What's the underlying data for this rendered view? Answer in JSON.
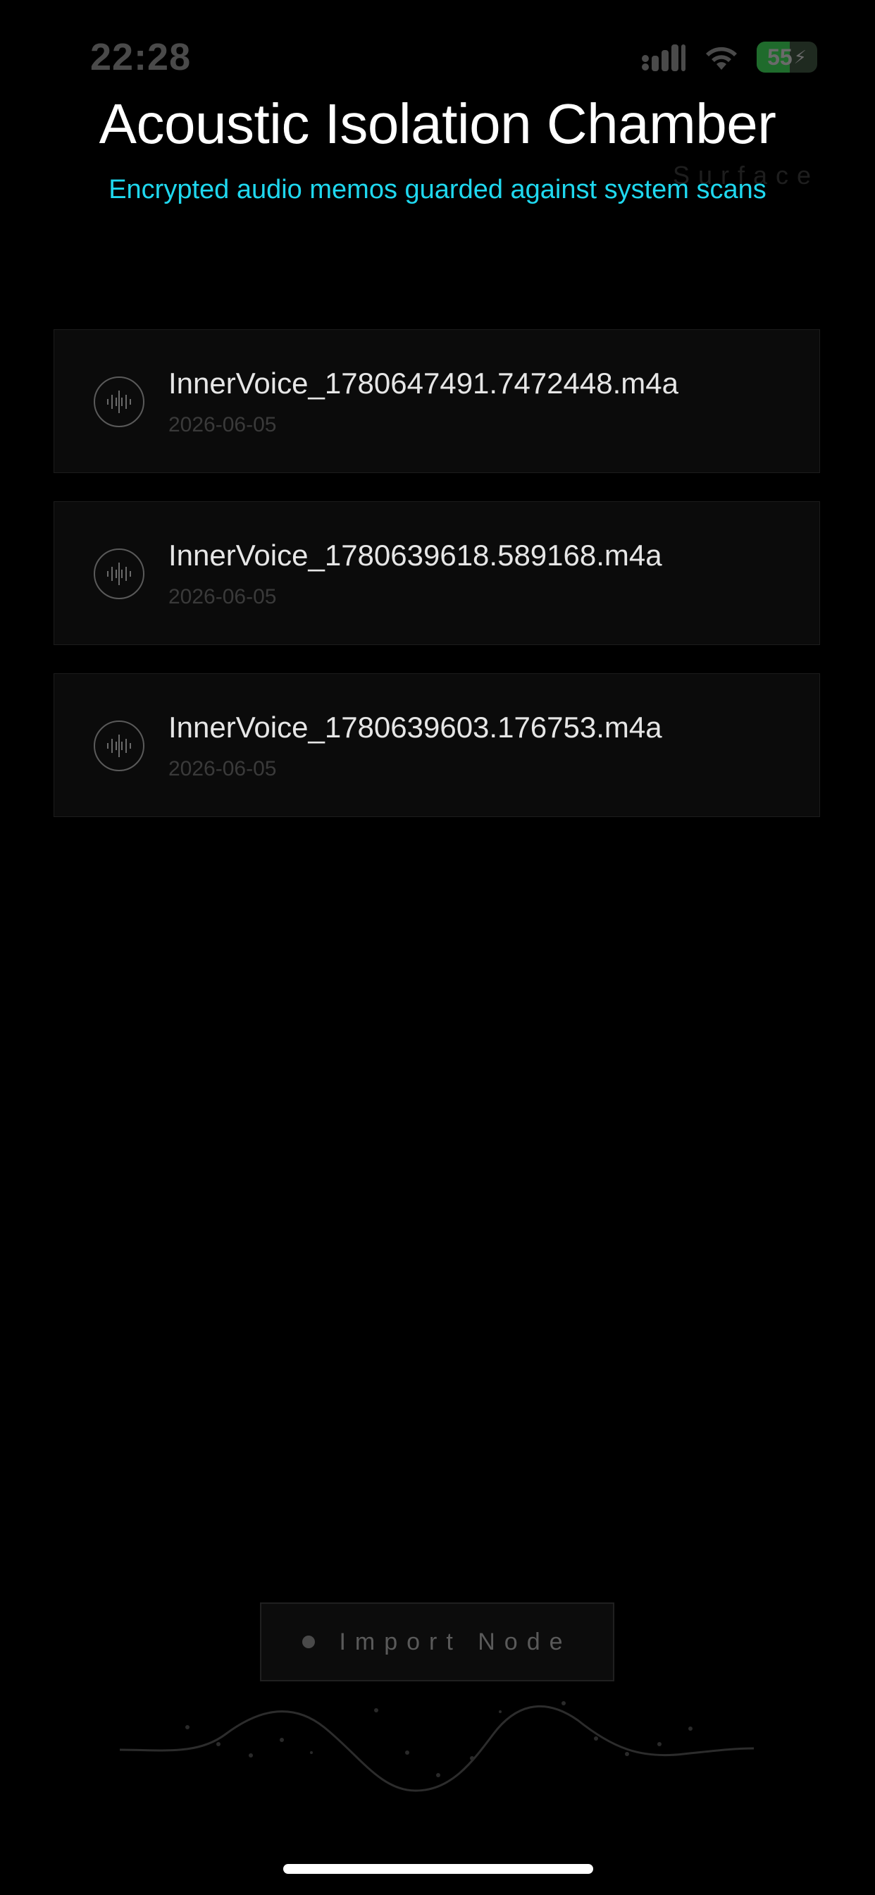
{
  "status_bar": {
    "time": "22:28",
    "battery_level": "55",
    "icons": [
      "signal-icon",
      "wifi-icon",
      "battery-charging-icon"
    ]
  },
  "header": {
    "title": "Acoustic Isolation Chamber",
    "subtitle": "Encrypted audio memos guarded against system scans",
    "surface_label": "Surface"
  },
  "files": [
    {
      "name": "InnerVoice_1780647491.7472448.m4a",
      "date": "2026-06-05",
      "icon": "waveform-icon"
    },
    {
      "name": "InnerVoice_1780639618.589168.m4a",
      "date": "2026-06-05",
      "icon": "waveform-icon"
    },
    {
      "name": "InnerVoice_1780639603.176753.m4a",
      "date": "2026-06-05",
      "icon": "waveform-icon"
    }
  ],
  "import_button": {
    "label": "Import Node"
  },
  "colors": {
    "background": "#000000",
    "accent": "#1fd8ef",
    "title": "#ffffff",
    "card_background": "#0b0b0b"
  }
}
